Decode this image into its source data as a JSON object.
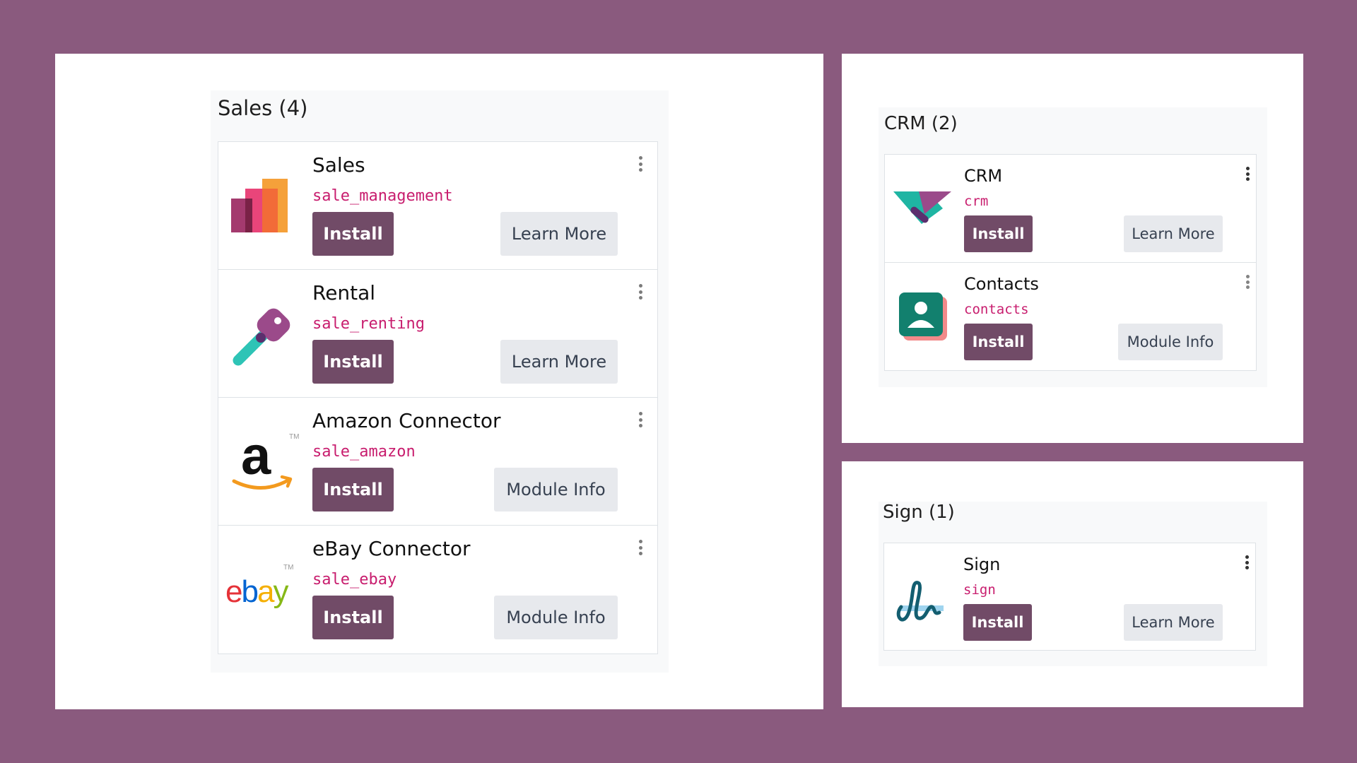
{
  "groups": {
    "sales": {
      "title": "Sales (4)",
      "apps": [
        {
          "name": "Sales",
          "technical": "sale_management",
          "install_label": "Install",
          "secondary_label": "Learn More",
          "icon": "sales-bars-icon"
        },
        {
          "name": "Rental",
          "technical": "sale_renting",
          "install_label": "Install",
          "secondary_label": "Learn More",
          "icon": "rental-key-icon"
        },
        {
          "name": "Amazon Connector",
          "technical": "sale_amazon",
          "install_label": "Install",
          "secondary_label": "Module Info",
          "icon": "amazon-logo-icon",
          "logo_text": "a",
          "tm": "TM"
        },
        {
          "name": "eBay Connector",
          "technical": "sale_ebay",
          "install_label": "Install",
          "secondary_label": "Module Info",
          "icon": "ebay-logo-icon",
          "logo_text": "ebay",
          "tm": "TM"
        }
      ]
    },
    "crm": {
      "title": "CRM (2)",
      "apps": [
        {
          "name": "CRM",
          "technical": "crm",
          "install_label": "Install",
          "secondary_label": "Learn More",
          "icon": "crm-handshake-icon"
        },
        {
          "name": "Contacts",
          "technical": "contacts",
          "install_label": "Install",
          "secondary_label": "Module Info",
          "icon": "contacts-card-icon"
        }
      ]
    },
    "sign": {
      "title": "Sign (1)",
      "apps": [
        {
          "name": "Sign",
          "technical": "sign",
          "install_label": "Install",
          "secondary_label": "Learn More",
          "icon": "sign-signature-icon"
        }
      ]
    }
  },
  "colors": {
    "background": "#8a5a7e",
    "install_button": "#714b67",
    "secondary_button": "#e7e9ed",
    "technical_name": "#c81d6e"
  }
}
